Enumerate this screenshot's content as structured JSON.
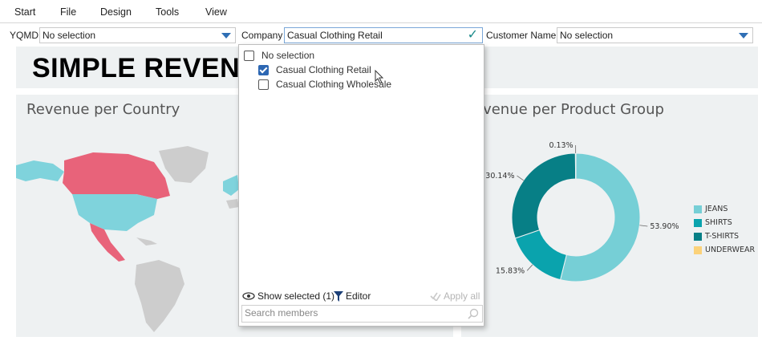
{
  "menu": [
    "Start",
    "File",
    "Design",
    "Tools",
    "View"
  ],
  "filters": {
    "yqmd": {
      "label": "YQMD",
      "value": "No selection"
    },
    "company": {
      "label": "Company",
      "value": "Casual Clothing Retail"
    },
    "customer": {
      "label": "Customer Name",
      "value": "No selection"
    }
  },
  "dashboard": {
    "title": "SIMPLE REVENU",
    "panel_country_title": "Revenue per Country",
    "panel_product_title": "evenue per Product Group"
  },
  "dropdown": {
    "no_selection_label": "No selection",
    "items": [
      {
        "label": "Casual Clothing Retail",
        "checked": true
      },
      {
        "label": "Casual Clothing Wholesale",
        "checked": false
      }
    ],
    "show_selected_label": "Show selected (1)",
    "editor_label": "Editor",
    "apply_all_label": "Apply all",
    "search_placeholder": "Search members"
  },
  "chart_data": {
    "type": "pie",
    "subtype": "donut",
    "title": "evenue per Product Group",
    "slices": [
      {
        "name": "JEANS",
        "value": 53.9,
        "label": "53.90%",
        "color": "#76cfd6"
      },
      {
        "name": "SHIRTS",
        "value": 15.83,
        "label": "15.83%",
        "color": "#0aa3ad"
      },
      {
        "name": "T-SHIRTS",
        "value": 30.14,
        "label": "30.14%",
        "color": "#077f86"
      },
      {
        "name": "UNDERWEAR",
        "value": 0.13,
        "label": "0.13%",
        "color": "#fbd27a"
      }
    ],
    "legend_position": "right"
  },
  "colors": {
    "accent_blue": "#2d67b3",
    "map_highlight": "#e8637a",
    "map_secondary": "#7fd3dc",
    "map_gray": "#cdcdcd"
  }
}
